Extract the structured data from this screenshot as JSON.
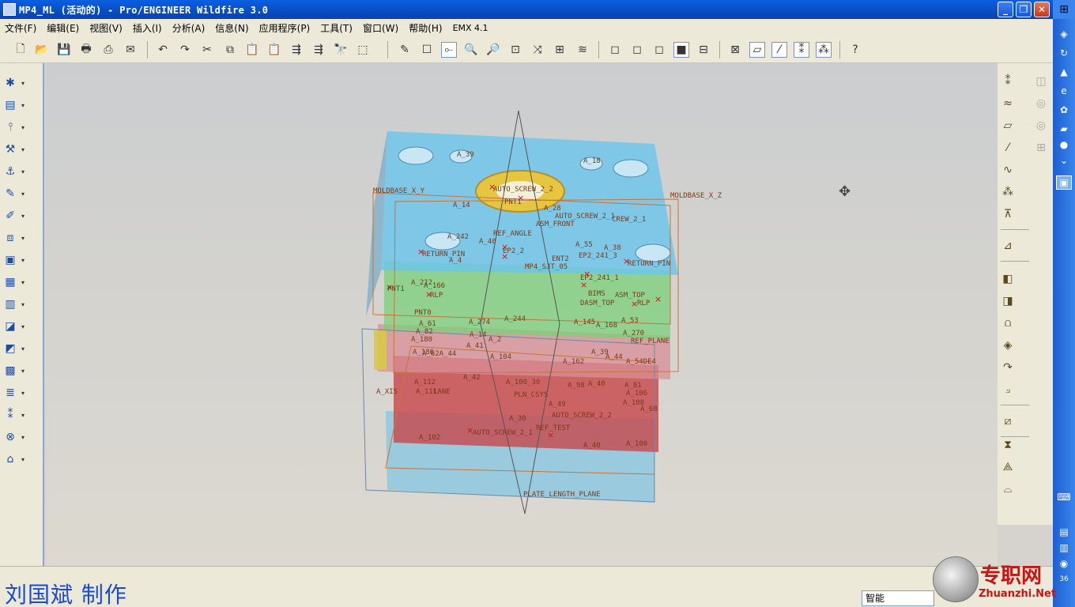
{
  "window": {
    "title": "MP4_ML (活动的) - Pro/ENGINEER Wildfire 3.0",
    "minimize_icon": "minimize-icon",
    "maximize_icon": "restore-icon",
    "close_icon": "close-icon"
  },
  "menu": {
    "items": [
      "文件(F)",
      "编辑(E)",
      "视图(V)",
      "插入(I)",
      "分析(A)",
      "信息(N)",
      "应用程序(P)",
      "工具(T)",
      "窗口(W)",
      "帮助(H)",
      "EMX 4.1"
    ]
  },
  "toolbar": {
    "icons": [
      "new-icon",
      "open-icon",
      "save-icon",
      "print-icon",
      "print-preview-icon",
      "email-icon",
      "undo-icon",
      "redo-icon",
      "cut-icon",
      "copy-icon",
      "paste-icon",
      "paste-special-icon",
      "regenerate-icon",
      "regen-manager-icon",
      "find-icon",
      "selection-box-icon",
      "repaint-icon",
      "spin-center-icon",
      "orient-mode-icon",
      "zoom-in-icon",
      "zoom-out-icon",
      "refit-icon",
      "reorient-icon",
      "saved-views-icon",
      "layers-icon",
      "wireframe-icon",
      "hidden-line-icon",
      "no-hidden-icon",
      "shading-icon",
      "model-tree-icon",
      "datum-display-icon",
      "datum-planes-icon",
      "datum-axes-icon",
      "datum-points-icon",
      "datum-csys-icon",
      "context-help-icon"
    ]
  },
  "left_toolbar": {
    "icons": [
      "emx-new-project-icon",
      "moldbase-icon",
      "ejector-pin-icon",
      "screw-icon",
      "dowel-icon",
      "slider-icon",
      "lifter-icon",
      "cooling-icon",
      "sprue-icon",
      "waterline-icon",
      "bom-icon",
      "drawing-icon",
      "component-status-icon",
      "assembly-icon",
      "mold-opening-icon",
      "classify-icon",
      "options-icon",
      "bolt-icon"
    ]
  },
  "right_toolbar": {
    "icons": [
      "datum-point-icon",
      "datum-axis-icon",
      "datum-plane-icon",
      "sketch-icon",
      "datum-curve-icon",
      "datum-csys-icon",
      "analysis-feature-icon",
      "insert-feature-icon",
      "extrude-icon",
      "revolve-icon",
      "sweep-icon",
      "blend-icon",
      "round-icon",
      "chamfer-icon",
      "draft-icon",
      "shell-icon",
      "rib-icon",
      "pattern-icon",
      "mirror-icon",
      "move-icon"
    ]
  },
  "model": {
    "labels": [
      "MOLDBASE_X_Y",
      "MOLDBASE_X_Z",
      "AUTO_SCREW_2_2",
      "PNT1",
      "AUTO_SCREW_2_1",
      "CREW_2_1",
      "ASM_FRONT",
      "REF_ANGLE",
      "A_39",
      "A_18",
      "A_14",
      "A_28",
      "A_242",
      "A_40",
      "A_55",
      "A_38",
      "RETURN_PIN",
      "RETURN_PIN",
      "A_4",
      "EP2_2",
      "EP2_241_3",
      "ENT2",
      "A_212",
      "PNT1",
      "MP4_SJT_05",
      "EP2_241_1",
      "A_166",
      "RLP",
      "BIMS",
      "RLP",
      "PNT0",
      "A_61",
      "A_274",
      "A_244",
      "A_14",
      "A_145",
      "A_168",
      "A_53",
      "A_270",
      "A_82",
      "A_41",
      "A_2",
      "REF_PLANE",
      "A_180",
      "A_186",
      "A_62A_44",
      "A_104",
      "A_162",
      "A_39",
      "A_44",
      "A_54DE4",
      "A_112",
      "A_42",
      "A_100_30",
      "A_98",
      "A_40",
      "A_81",
      "A_106",
      "A_108",
      "A_XIS",
      "A_111",
      "LANE",
      "PLN_CSYS",
      "A_49",
      "AUTO_SCREW_2_2",
      "A_68",
      "A_30",
      "AUTO_SCREW_2_1",
      "A_102",
      "REF_TEST",
      "A_40",
      "A_100",
      "PLATE_LENGTH_PLANE",
      "ASM_TOP",
      "DASM_TOP"
    ]
  },
  "status": {
    "author_caption": "刘国斌 制作",
    "filter_value": "智能",
    "watermark_cn": "专职网",
    "watermark_url": "Zhuanzhi.Net",
    "tray_time": "36"
  }
}
